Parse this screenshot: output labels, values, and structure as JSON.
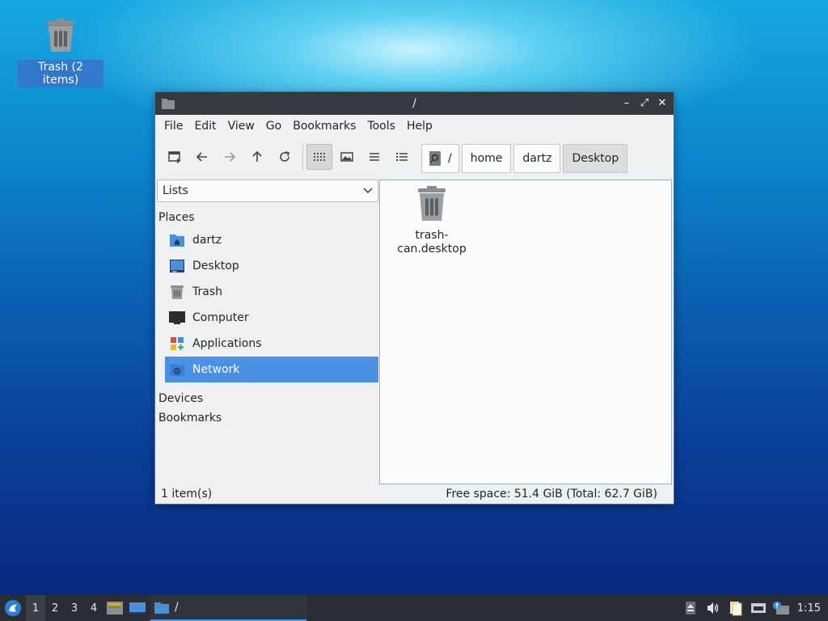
{
  "desktop": {
    "trash_label": "Trash (2 items)"
  },
  "window": {
    "title": "/",
    "controls": {
      "minimize": "–",
      "maximize": "⤢",
      "close": "✕"
    }
  },
  "menubar": {
    "items": [
      "File",
      "Edit",
      "View",
      "Go",
      "Bookmarks",
      "Tools",
      "Help"
    ]
  },
  "pathbar": {
    "root": "/",
    "crumbs": [
      "home",
      "dartz",
      "Desktop"
    ]
  },
  "sidebar": {
    "mode": "Lists",
    "places_title": "Places",
    "places": [
      {
        "label": "dartz",
        "icon": "home-folder-icon"
      },
      {
        "label": "Desktop",
        "icon": "desktop-icon"
      },
      {
        "label": "Trash",
        "icon": "trash-icon"
      },
      {
        "label": "Computer",
        "icon": "computer-icon"
      },
      {
        "label": "Applications",
        "icon": "applications-icon"
      },
      {
        "label": "Network",
        "icon": "network-icon"
      }
    ],
    "selected": "Network",
    "devices_title": "Devices",
    "bookmarks_title": "Bookmarks"
  },
  "files": [
    {
      "name": "trash-can.desktop",
      "line1": "trash-",
      "line2": "can.desktop"
    }
  ],
  "status": {
    "count": "1 item(s)",
    "free_space": "Free space: 51.4 GiB (Total: 62.7 GiB)"
  },
  "taskbar": {
    "workspaces": [
      "1",
      "2",
      "3",
      "4"
    ],
    "active_workspace": "1",
    "task_title": "/",
    "clock": "1:15"
  },
  "colors": {
    "accent": "#4a90e5",
    "titlebar": "#353a41",
    "taskbar": "#2b2f35"
  }
}
